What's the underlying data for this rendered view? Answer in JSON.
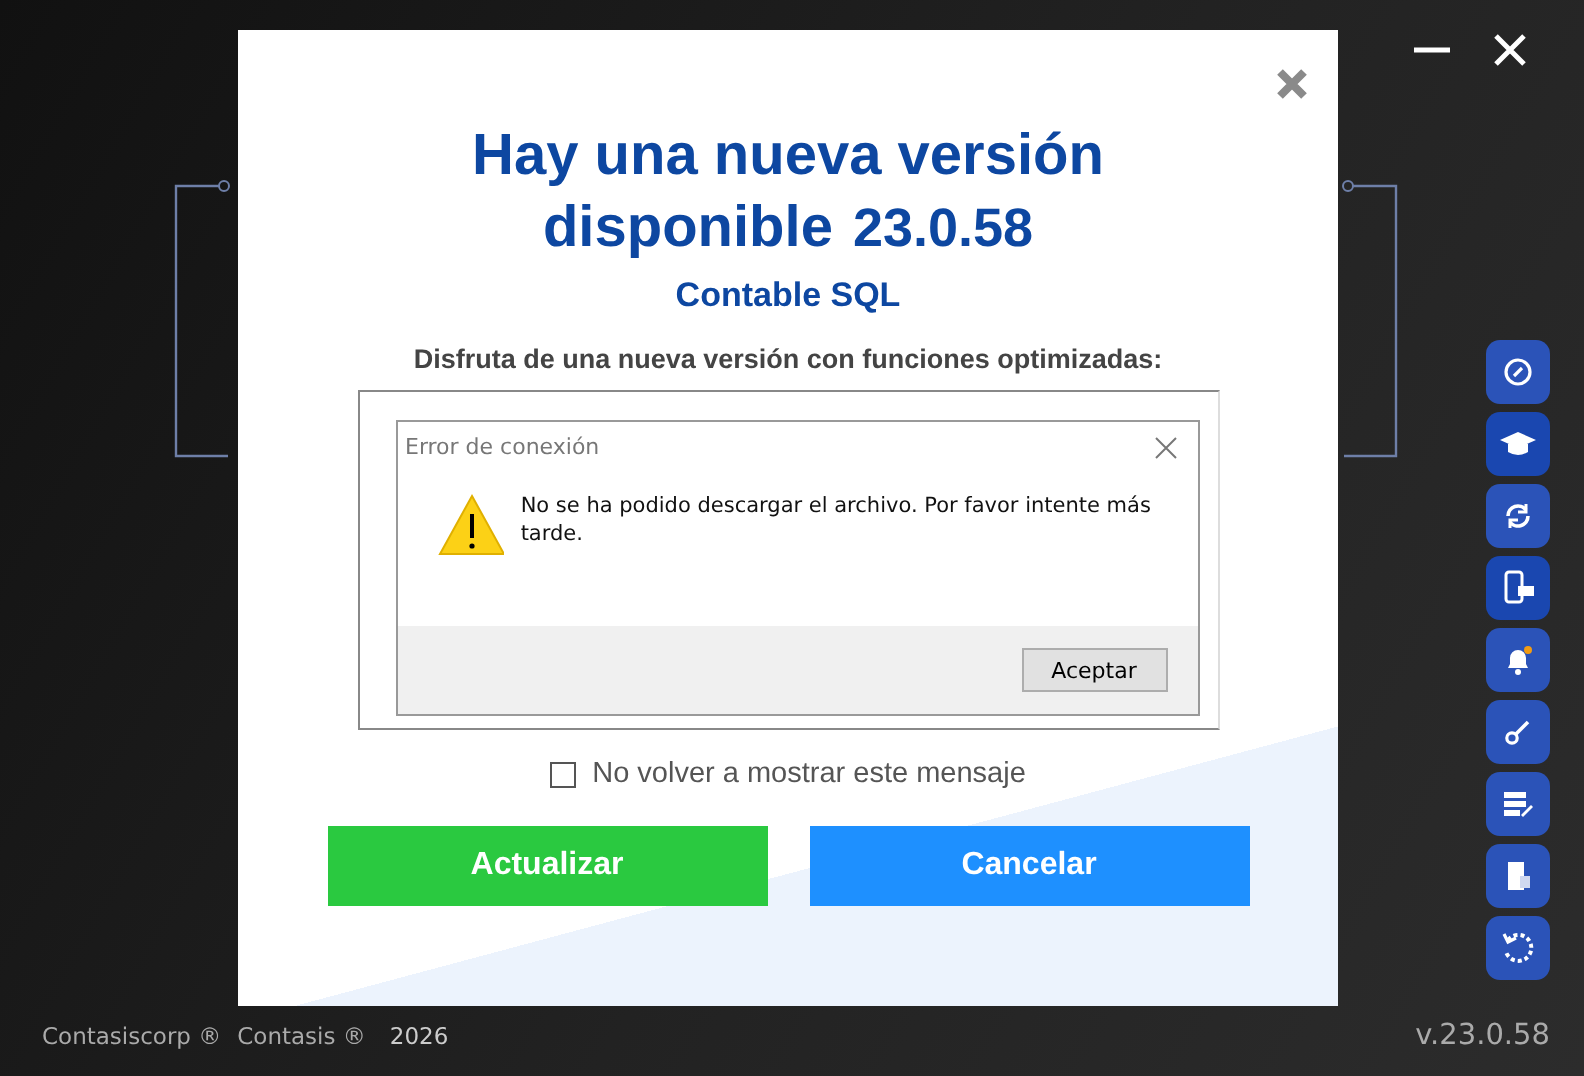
{
  "dialog": {
    "title_line_1": "Hay una nueva versión",
    "title_line_2": "disponible",
    "version": "23.0.58",
    "product": "Contable SQL",
    "description": "Disfruta de una nueva versión con funciones optimizadas:",
    "error_dialog": {
      "title": "Error de conexión",
      "message": "No se ha podido descargar el archivo. Por favor intente más tarde.",
      "button": "Aceptar"
    },
    "checkbox": {
      "label": "No volver a mostrar este mensaje",
      "checked": false
    },
    "buttons": [
      {
        "label": "Actualizar",
        "kind": "primary"
      },
      {
        "label": "Cancelar",
        "kind": "secondary"
      }
    ]
  },
  "footer": {
    "company": "Contasiscorp ®",
    "brand": "Contasis ®",
    "year": "2026",
    "version": "v.23.0.58"
  }
}
